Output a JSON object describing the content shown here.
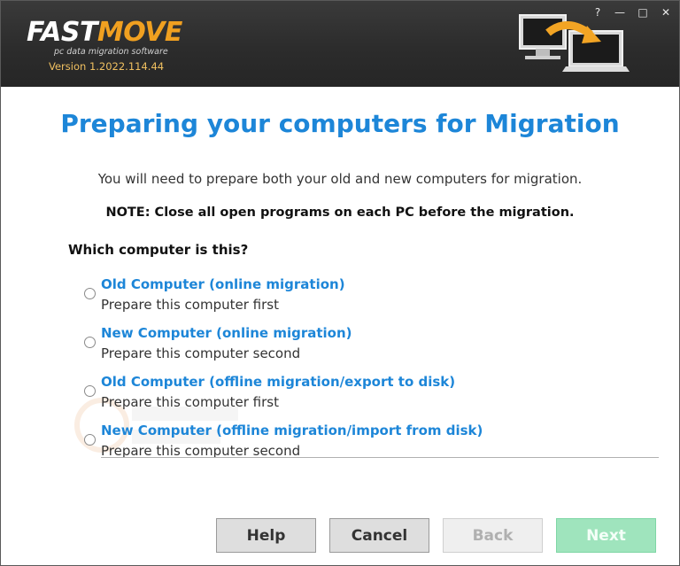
{
  "header": {
    "logo_part1": "FAST",
    "logo_part2": "MOVE",
    "tagline": "pc data migration software",
    "version": "Version 1.2022.114.44",
    "window_controls": [
      "?",
      "—",
      "□",
      "✕"
    ]
  },
  "main": {
    "title": "Preparing your computers for Migration",
    "intro": "You will need to prepare both your old and new computers for migration.",
    "note": "NOTE: Close all open programs on each PC before the migration.",
    "question": "Which computer is this?",
    "options": [
      {
        "title": "Old Computer (online migration)",
        "subtitle": "Prepare this computer first"
      },
      {
        "title": "New Computer (online migration)",
        "subtitle": "Prepare this computer second"
      },
      {
        "title": "Old Computer (offline migration/export to disk)",
        "subtitle": "Prepare this computer first"
      },
      {
        "title": "New Computer (offline migration/import from disk)",
        "subtitle": "Prepare this computer second"
      }
    ]
  },
  "buttons": {
    "help": "Help",
    "cancel": "Cancel",
    "back": "Back",
    "next": "Next"
  },
  "colors": {
    "accent": "#1d86d8",
    "logo_orange": "#f0a020",
    "next_disabled": "#9fe4bd"
  }
}
